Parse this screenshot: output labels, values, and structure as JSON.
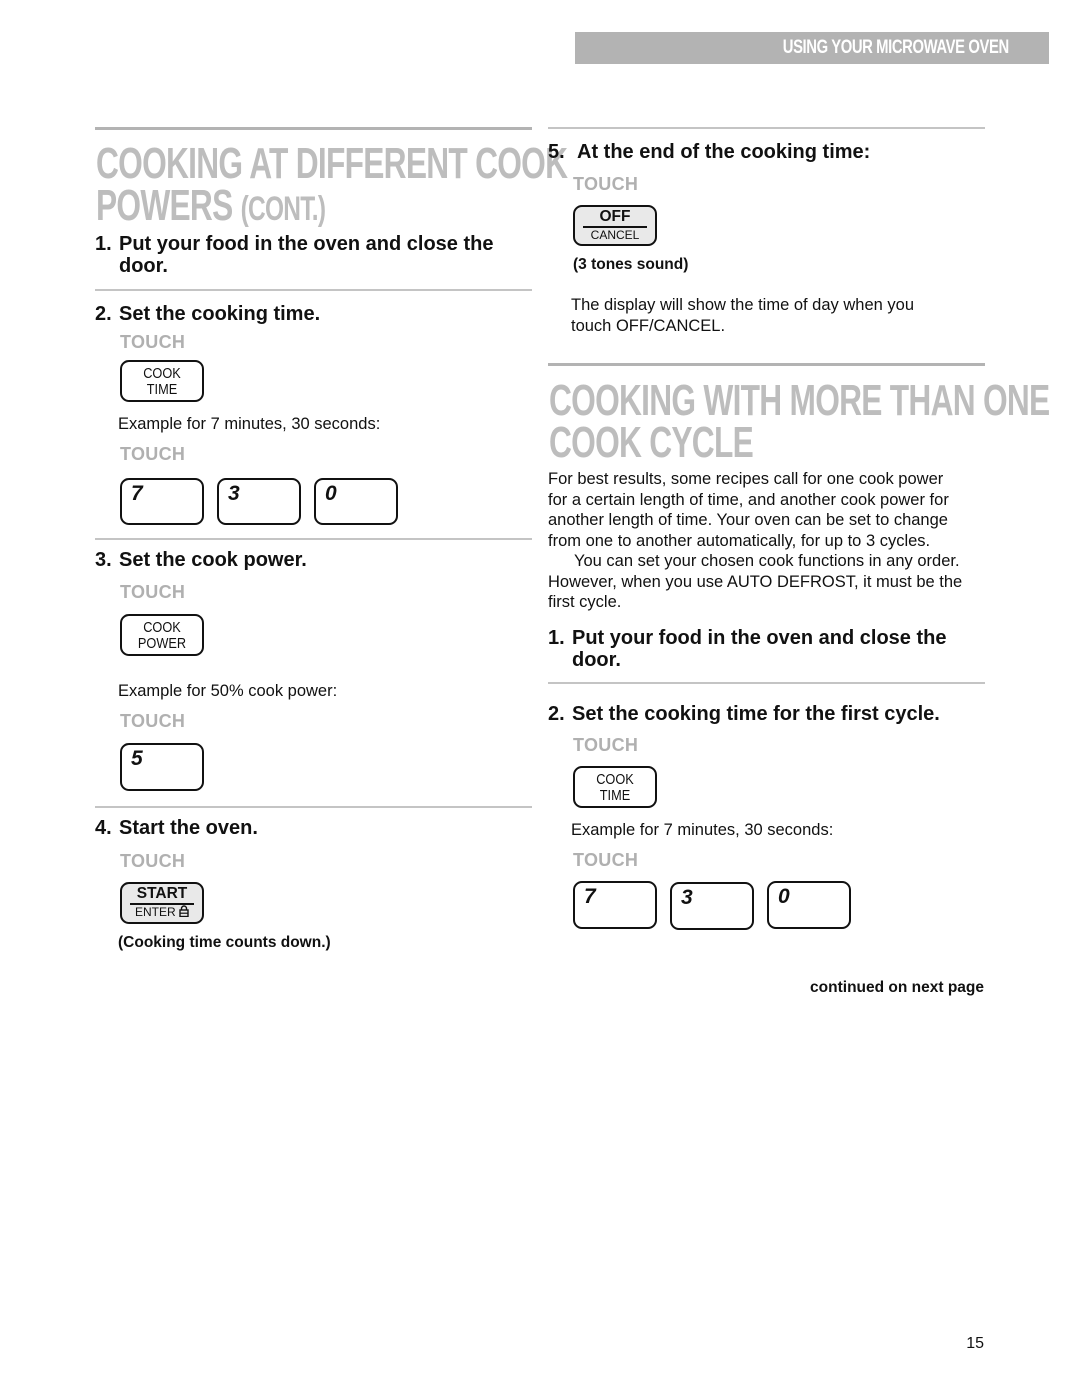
{
  "header": {
    "section_label": "USING YOUR MICROWAVE OVEN"
  },
  "left": {
    "title_line1": "Cooking at different cook",
    "title_line2_main": "powers",
    "title_line2_suffix": "(cont.)",
    "step1": {
      "num": "1.",
      "text_line1": "Put your food in the oven and close the",
      "text_line2": "door."
    },
    "step2": {
      "num": "2.",
      "text": "Set the cooking time.",
      "touch1": "TOUCH",
      "key1": {
        "line1": "COOK",
        "line2": "TIME"
      },
      "example": "Example for 7 minutes, 30 seconds:",
      "touch2": "TOUCH",
      "digits": [
        "7",
        "3",
        "0"
      ]
    },
    "step3": {
      "num": "3.",
      "text": "Set the cook power.",
      "touch1": "TOUCH",
      "key1": {
        "line1": "COOK",
        "line2": "POWER"
      },
      "example": "Example for 50% cook power:",
      "touch2": "TOUCH",
      "digits": [
        "5"
      ]
    },
    "step4": {
      "num": "4.",
      "text": "Start the oven.",
      "touch": "TOUCH",
      "key": {
        "top": "START",
        "sub": "ENTER",
        "icon": "lock-icon"
      },
      "note": "(Cooking time counts down.)"
    }
  },
  "right": {
    "step5": {
      "num": "5.",
      "text": "At the end of the cooking time:",
      "touch": "TOUCH",
      "key": {
        "top": "OFF",
        "sub": "CANCEL"
      },
      "note": "(3 tones sound)",
      "desc_line1": "The display will show the time of day when you",
      "desc_line2": "touch OFF/CANCEL."
    },
    "title_line1": "Cooking with more than one",
    "title_line2": "cook cycle",
    "intro_lines": [
      "For best results, some recipes call for one cook power",
      "for a certain length of time, and another cook power for",
      "another length of time. Your oven can be set to change",
      "from one to another automatically, for up to 3 cycles."
    ],
    "intro2_lines": [
      "You can set your chosen cook functions in any order.",
      "However, when you use AUTO DEFROST, it must be the",
      "first cycle."
    ],
    "step1": {
      "num": "1.",
      "text_line1": "Put your food in the oven and close the",
      "text_line2": "door."
    },
    "step2": {
      "num": "2.",
      "text": "Set the cooking time for the first cycle.",
      "touch1": "TOUCH",
      "key1": {
        "line1": "COOK",
        "line2": "TIME"
      },
      "example": "Example for 7 minutes, 30 seconds:",
      "touch2": "TOUCH",
      "digits": [
        "7",
        "3",
        "0"
      ]
    },
    "continued": "continued on next page"
  },
  "footer": {
    "page_number": "15"
  }
}
